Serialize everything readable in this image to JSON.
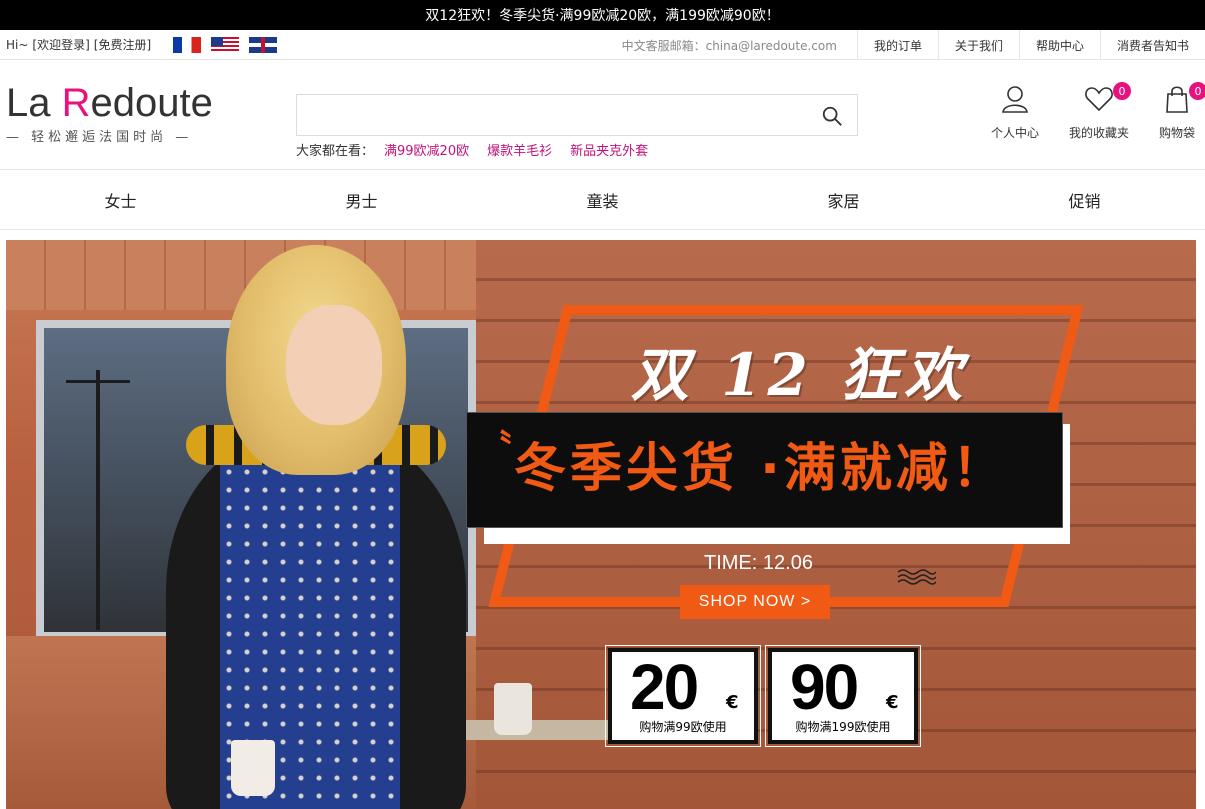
{
  "promo_bar": {
    "text": "双12狂欢！冬季尖货·满99欧减20欧，满199欧减90欧！"
  },
  "util": {
    "greeting": "Hi~",
    "login": "[欢迎登录]",
    "register": "[免费注册]",
    "flags": [
      "flag-france-icon",
      "flag-usa-icon",
      "flag-uk-icon"
    ],
    "email": "中文客服邮箱：china@laredoute.com",
    "links": [
      "我的订单",
      "关于我们",
      "帮助中心",
      "消费者告知书"
    ]
  },
  "logo": {
    "main_prefix": "La ",
    "main_r": "R",
    "main_suffix": "edoute",
    "sub": "— 轻松邂逅法国时尚 —"
  },
  "search": {
    "value": "",
    "placeholder": "",
    "hot_label": "大家都在看：",
    "hot_tags": [
      "满99欧减20欧",
      "爆款羊毛衫",
      "新品夹克外套"
    ]
  },
  "header_icons": {
    "account": "个人中心",
    "favorites": "我的收藏夹",
    "favorites_count": "0",
    "cart": "购物袋",
    "cart_count": "0"
  },
  "nav": [
    "女士",
    "男士",
    "童装",
    "家居",
    "促销"
  ],
  "banner": {
    "title": "双 12 狂欢",
    "headline": "冬季尖货 ·满就减！",
    "quote_mark": "〝",
    "time": "TIME: 12.06",
    "shop_button": "SHOP NOW >",
    "coupons": [
      {
        "amount": "20",
        "currency": "€",
        "desc": "购物满99欧使用"
      },
      {
        "amount": "90",
        "currency": "€",
        "desc": "购物满199欧使用"
      }
    ]
  },
  "colors": {
    "accent": "#e6127f",
    "promo_orange": "#f15a14",
    "top_bar": "#000000"
  }
}
